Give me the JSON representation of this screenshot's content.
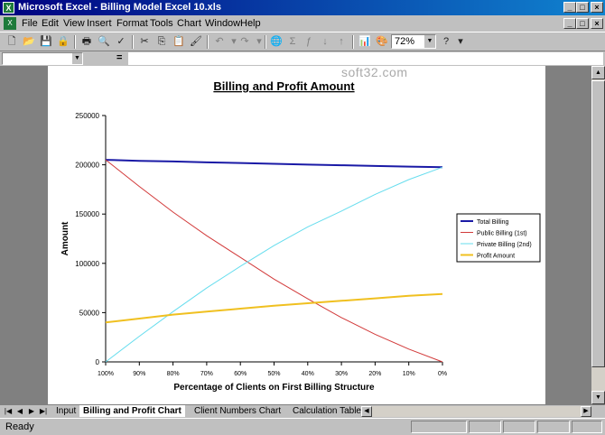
{
  "window": {
    "title": "Microsoft Excel - Billing Model Excel 10.xls"
  },
  "menu": [
    "File",
    "Edit",
    "View",
    "Insert",
    "Format",
    "Tools",
    "Chart",
    "Window",
    "Help"
  ],
  "toolbar": {
    "zoom": "72%"
  },
  "formula_bar": {
    "equals": "="
  },
  "watermark": "soft32.com",
  "chart_data": {
    "type": "line",
    "title": "Billing and Profit Amount",
    "xlabel": "Percentage of Clients on First Billing Structure",
    "ylabel": "Amount",
    "categories": [
      "100%",
      "90%",
      "80%",
      "70%",
      "60%",
      "50%",
      "40%",
      "30%",
      "20%",
      "10%",
      "0%"
    ],
    "ylim": [
      0,
      250000
    ],
    "yticks": [
      0,
      50000,
      100000,
      150000,
      200000,
      250000
    ],
    "legend": "right",
    "series": [
      {
        "name": "Total Billing",
        "color": "#1a1aa6",
        "width": 2,
        "values": [
          205000,
          204000,
          203400,
          202500,
          201800,
          201000,
          200200,
          199500,
          198800,
          198200,
          197500
        ]
      },
      {
        "name": "Public Billing (1st)",
        "color": "#d23a3a",
        "width": 1,
        "values": [
          205000,
          178000,
          152000,
          128000,
          106000,
          84000,
          64000,
          45000,
          28000,
          13000,
          0
        ]
      },
      {
        "name": "Private Billing (2nd)",
        "color": "#66ddee",
        "width": 1,
        "values": [
          0,
          26000,
          51000,
          75000,
          97000,
          118000,
          137000,
          153000,
          170000,
          185000,
          197500
        ]
      },
      {
        "name": "Profit Amount",
        "color": "#f0c020",
        "width": 2,
        "values": [
          40000,
          44000,
          48000,
          51000,
          54000,
          57000,
          59500,
          62000,
          64500,
          67000,
          69000
        ]
      }
    ]
  },
  "tabs": [
    "Input",
    "Billing and Profit Chart",
    "Client Numbers Chart",
    "Calculation Table"
  ],
  "active_tab": 1,
  "status": "Ready"
}
